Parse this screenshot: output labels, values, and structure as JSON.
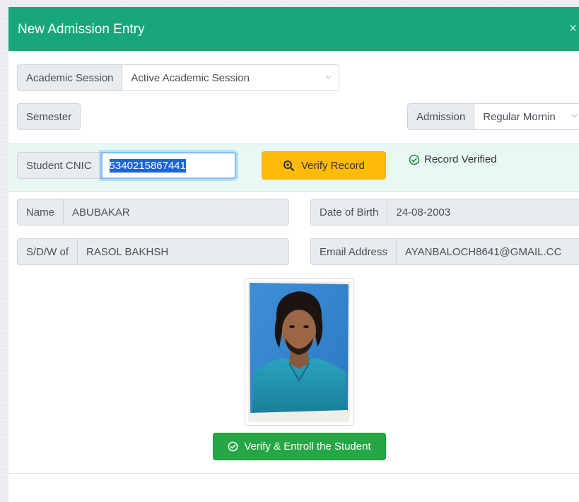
{
  "modal": {
    "title": "New Admission Entry",
    "close_glyph": "×"
  },
  "form": {
    "academic_session": {
      "label": "Academic Session",
      "selected": "Active Academic Session"
    },
    "semester": {
      "label": "Semester"
    },
    "admission": {
      "label": "Admission",
      "selected": "Regular Mornin"
    },
    "cnic": {
      "label": "Student CNIC",
      "value": "5340215867441"
    },
    "verify_button": {
      "label": "Verify Record",
      "icon": "search-icon"
    },
    "verified_status": {
      "text": "Record Verified",
      "icon": "check-circle-icon"
    }
  },
  "student": {
    "name": {
      "label": "Name",
      "value": "ABUBAKAR"
    },
    "dob": {
      "label": "Date of Birth",
      "value": "24-08-2003"
    },
    "parent": {
      "label": "S/D/W of",
      "value": "RASOL BAKHSH"
    },
    "email": {
      "label": "Email Address",
      "value": "AYANBALOCH8641@GMAIL.CC"
    }
  },
  "enroll_button": {
    "label": "Verify & Entroll the Student",
    "icon": "check-circle-icon"
  },
  "colors": {
    "header": "#17a679",
    "verify_button": "#ffbb07",
    "enroll_button": "#26a745",
    "band": "#e8f8f4"
  }
}
